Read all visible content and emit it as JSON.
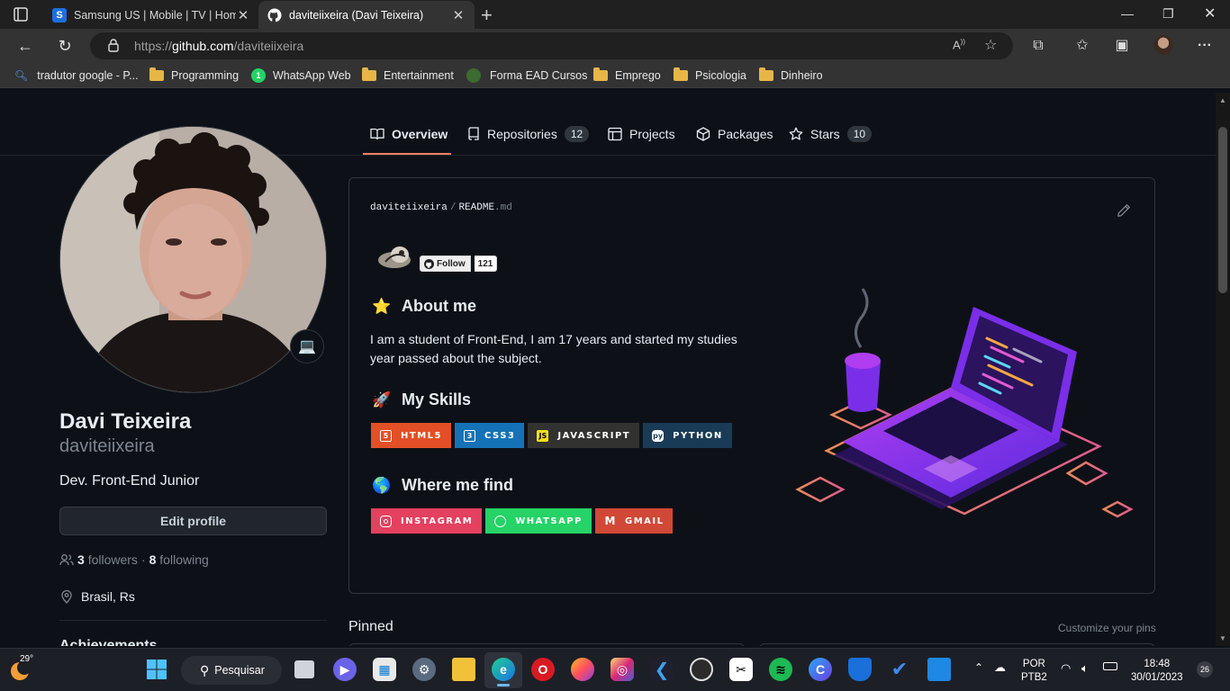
{
  "browser": {
    "tabs": [
      {
        "title": "Samsung US | Mobile | TV | Home",
        "favicon": "S",
        "color": "#1e6fe0"
      },
      {
        "title": "daviteiixeira (Davi Teixeira)",
        "favicon": "github-icon",
        "color": "#ffffff"
      }
    ],
    "url_prefix": "https://",
    "url_domain": "github.com",
    "url_path": "/daviteiixeira",
    "bookmarks": [
      "tradutor google - P...",
      "Programming",
      "WhatsApp Web",
      "Entertainment",
      "Forma EAD Cursos",
      "Emprego",
      "Psicologia",
      "Dinheiro"
    ]
  },
  "profile_tabs": [
    {
      "label": "Overview"
    },
    {
      "label": "Repositories",
      "count": "12"
    },
    {
      "label": "Projects"
    },
    {
      "label": "Packages"
    },
    {
      "label": "Stars",
      "count": "10"
    }
  ],
  "profile": {
    "full_name": "Davi Teixeira",
    "login": "daviteiixeira",
    "bio": "Dev. Front-End Junior",
    "edit_label": "Edit profile",
    "followers": "3",
    "followers_label": "followers",
    "dot": "·",
    "following": "8",
    "following_label": "following",
    "location": "Brasil, Rs",
    "achievements": "Achievements",
    "status_emoji": "💻"
  },
  "readme": {
    "owner": "daviteiixeira",
    "sep": "/",
    "file": "README",
    "ext": ".md",
    "follow_label": "Follow",
    "follow_count": "121",
    "about_heading": "About me",
    "about_emoji": "⭐",
    "about_text": " I am a student of Front-End, I am 17 years and started my studies year passed about the subject.",
    "skills_heading": "My Skills",
    "skills_emoji": "🚀",
    "skills": [
      {
        "label": "HTML5",
        "color": "#e34f26",
        "icon": "5"
      },
      {
        "label": "CSS3",
        "color": "#1572b6",
        "icon": "3"
      },
      {
        "label": "JAVASCRIPT",
        "color": "#323330",
        "icon": "JS"
      },
      {
        "label": "PYTHON",
        "color": "#1a3b56",
        "icon": "py"
      }
    ],
    "find_heading": "Where me find",
    "find_emoji": "🌎",
    "socials": [
      {
        "label": "INSTAGRAM",
        "color": "#e4405f",
        "icon": "instagram-icon"
      },
      {
        "label": "WHATSAPP",
        "color": "#25d366",
        "icon": "whatsapp-icon"
      },
      {
        "label": "GMAIL",
        "color": "#d14836",
        "icon": "gmail-icon"
      }
    ]
  },
  "pinned": {
    "title": "Pinned",
    "customize": "Customize your pins"
  },
  "taskbar": {
    "temperature": "29°",
    "search": "Pesquisar",
    "lang1": "POR",
    "lang2": "PTB2",
    "time": "18:48",
    "date": "30/01/2023",
    "notifications": "26"
  }
}
